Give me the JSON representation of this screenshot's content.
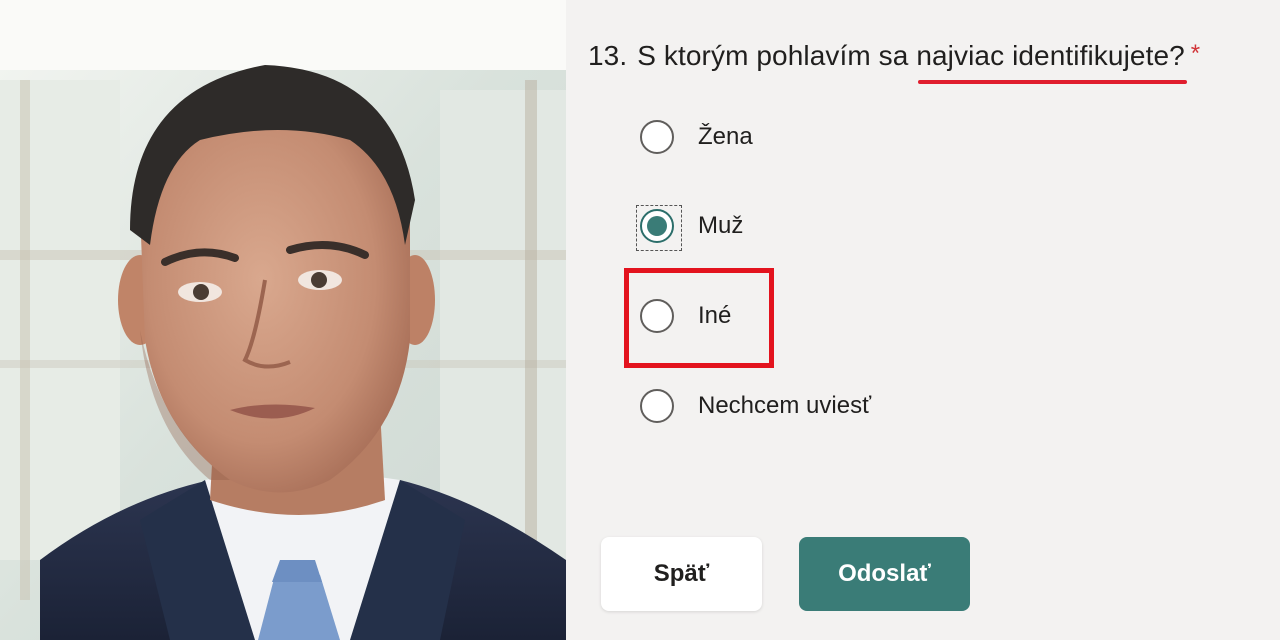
{
  "photo": {
    "subject": "man-in-suit-portrait"
  },
  "question": {
    "number": "13.",
    "text_before": "S ktorým pohlavím sa ",
    "text_underlined": "najviac identifikujete?",
    "required_mark": "*"
  },
  "options": [
    {
      "label": "Žena",
      "selected": false
    },
    {
      "label": "Muž",
      "selected": true
    },
    {
      "label": "Iné",
      "selected": false
    },
    {
      "label": "Nechcem uviesť",
      "selected": false
    }
  ],
  "buttons": {
    "back_label": "Späť",
    "submit_label": "Odoslať"
  },
  "colors": {
    "accent": "#3a7c77",
    "highlight_red": "#e3131e",
    "required_red": "#d13438",
    "background": "#f3f2f1"
  }
}
